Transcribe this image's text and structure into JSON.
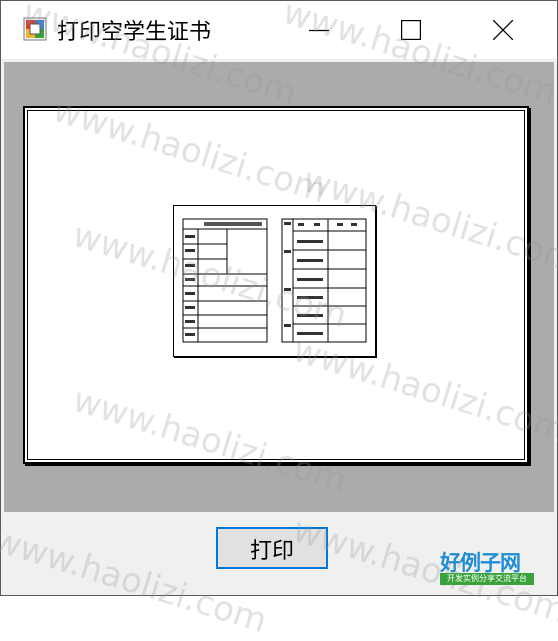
{
  "window": {
    "title": "打印空学生证书",
    "icon": "app-icon",
    "controls": {
      "minimize": "minimize-icon",
      "maximize": "maximize-icon",
      "close": "close-icon"
    }
  },
  "preview": {
    "certificate_icon": "student-certificate-thumbnail"
  },
  "buttons": {
    "print_label": "打印"
  },
  "watermark": {
    "text": "www.haolizi.com"
  },
  "logo": {
    "title": "好例子网",
    "subtitle": "开发实例分享交流平台"
  },
  "colors": {
    "accent": "#0078d7",
    "client_bg": "#ababab",
    "logo_blue": "#1f8dd6",
    "logo_green": "#3aa23a"
  }
}
